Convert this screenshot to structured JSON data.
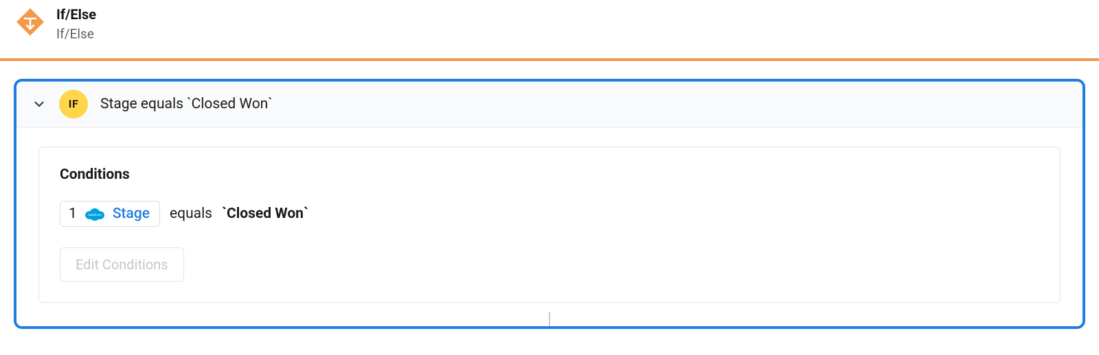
{
  "header": {
    "title": "If/Else",
    "subtitle": "If/Else"
  },
  "panel": {
    "badge_label": "IF",
    "summary": "Stage equals `Closed Won`"
  },
  "conditions": {
    "title": "Conditions",
    "rows": {
      "0": {
        "index": "1",
        "field": "Stage",
        "operator": "equals",
        "value": "`Closed Won`"
      }
    },
    "edit_label": "Edit Conditions"
  }
}
